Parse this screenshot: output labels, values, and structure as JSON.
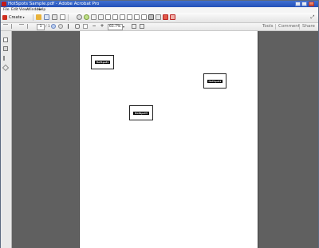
{
  "window": {
    "title": "HotSpots Sample.pdf - Adobe Acrobat Pro"
  },
  "menu": {
    "items": [
      "File",
      "Edit",
      "View",
      "Window",
      "Help"
    ]
  },
  "toolbar": {
    "create_label": "Create",
    "create_caret": "▾",
    "expand_glyph": "⤢"
  },
  "nav_toolbar": {
    "page_number": "1",
    "page_total": "/ 1",
    "zoom_value": "65.7%",
    "zoom_caret": "▾"
  },
  "task_tabs": [
    "Tools",
    "Comment",
    "Share"
  ],
  "document": {
    "hotspots": [
      {
        "label": "HotSpot1"
      },
      {
        "label": "HotSpot2"
      },
      {
        "label": "HotSpot3"
      }
    ]
  },
  "colors": {
    "titlebar": "#2451b8",
    "document_bg": "#606060",
    "acrobat_red": "#c21b17"
  }
}
